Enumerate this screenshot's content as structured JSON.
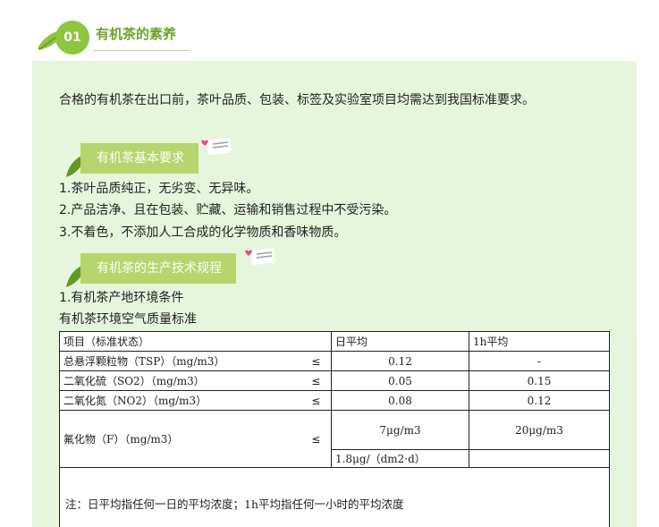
{
  "section": {
    "number": "01",
    "title": "有机茶的素养",
    "icon": "leaf-icon"
  },
  "intro": "合格的有机茶在出口前，茶叶品质、包装、标签及实验室项目均需达到我国标准要求。",
  "basic": {
    "heading": "有机茶基本要求",
    "items": [
      "1.茶叶品质纯正，无劣变、无异味。",
      "2.产品洁净、且在包装、贮藏、运输和销售过程中不受污染。",
      "3.不着色，不添加人工合成的化学物质和香味物质。"
    ]
  },
  "tech": {
    "heading": "有机茶的生产技术规程",
    "item1": "1.有机茶产地环境条件",
    "table_caption": "有机茶环境空气质量标准"
  },
  "table": {
    "header": {
      "item": "项目（标准状态）",
      "day": "日平均",
      "hour": "1h平均"
    },
    "rows": [
      {
        "name": "总悬浮颗粒物（TSP）（mg/m3）",
        "le": "≤",
        "day": "0.12",
        "hour": "-"
      },
      {
        "name": "二氧化硫（SO2）（mg/m3）",
        "le": "≤",
        "day": "0.05",
        "hour": "0.15"
      },
      {
        "name": "二氧化氮（NO2）（mg/m3）",
        "le": "≤",
        "day": "0.08",
        "hour": "0.12"
      }
    ],
    "fluoride": {
      "name": "氟化物（F）（mg/m3）",
      "le": "≤",
      "day": "7μg/m3",
      "hour": "20μg/m3",
      "extra": "1.8μg/（dm2·d）"
    },
    "note": "注：日平均指任何一日的平均浓度；1h平均指任何一小时的平均浓度"
  },
  "colors": {
    "green_accent": "#8dc63f",
    "title_green": "#6aa52c",
    "panel_bg": "#e6f6dd",
    "tag_bg": "#b6d56c"
  }
}
